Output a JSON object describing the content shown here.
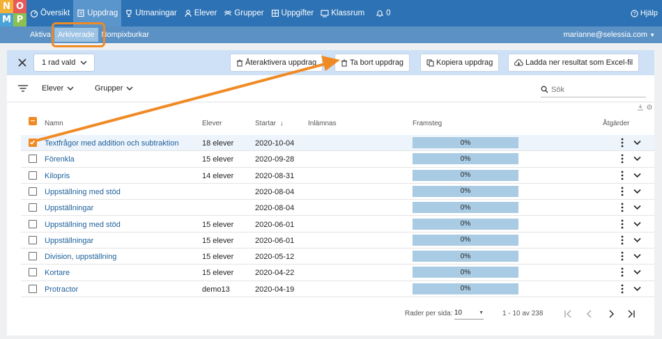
{
  "logo": [
    "N",
    "O",
    "M",
    "P"
  ],
  "nav": [
    {
      "label": "Översikt",
      "icon": "dashboard-icon"
    },
    {
      "label": "Uppdrag",
      "icon": "document-icon",
      "active": true
    },
    {
      "label": "Utmaningar",
      "icon": "trophy-icon"
    },
    {
      "label": "Elever",
      "icon": "person-icon"
    },
    {
      "label": "Grupper",
      "icon": "group-icon"
    },
    {
      "label": "Uppgifter",
      "icon": "grid-icon"
    },
    {
      "label": "Klassrum",
      "icon": "classroom-icon"
    },
    {
      "label": "0",
      "icon": "bell-icon"
    }
  ],
  "help_label": "Hjälp",
  "subnav": [
    {
      "label": "Aktiva"
    },
    {
      "label": "Arkiverade",
      "active": true
    },
    {
      "label": "Nompixburkar"
    }
  ],
  "user_email": "marianne@selessia.com",
  "actionbar": {
    "selected_label": "1 rad vald",
    "reactivate": "Återaktivera uppdrag",
    "delete": "Ta bort uppdrag",
    "copy": "Kopiera uppdrag",
    "download": "Ladda ner resultat som Excel-fil"
  },
  "filters": {
    "students": "Elever",
    "groups": "Grupper",
    "search_placeholder": "Sök"
  },
  "columns": {
    "name": "Namn",
    "students": "Elever",
    "starts": "Startar",
    "due": "Inlämnas",
    "progress": "Framsteg",
    "actions": "Åtgärder"
  },
  "rows": [
    {
      "name": "Textfrågor med addition och subtraktion",
      "students": "18 elever",
      "starts": "2020-10-04",
      "progress": "0%",
      "checked": true
    },
    {
      "name": "Förenkla",
      "students": "15 elever",
      "starts": "2020-09-28",
      "progress": "0%",
      "checked": false
    },
    {
      "name": "Kilopris",
      "students": "14 elever",
      "starts": "2020-08-31",
      "progress": "0%",
      "checked": false
    },
    {
      "name": "Uppställning med stöd",
      "students": "",
      "starts": "2020-08-04",
      "progress": "0%",
      "checked": false
    },
    {
      "name": "Uppställningar",
      "students": "",
      "starts": "2020-08-04",
      "progress": "0%",
      "checked": false
    },
    {
      "name": "Uppställning med stöd",
      "students": "15 elever",
      "starts": "2020-06-01",
      "progress": "0%",
      "checked": false
    },
    {
      "name": "Uppställningar",
      "students": "15 elever",
      "starts": "2020-06-01",
      "progress": "0%",
      "checked": false
    },
    {
      "name": "Division, uppställning",
      "students": "15 elever",
      "starts": "2020-05-12",
      "progress": "0%",
      "checked": false
    },
    {
      "name": "Kortare",
      "students": "15 elever",
      "starts": "2020-04-22",
      "progress": "0%",
      "checked": false
    },
    {
      "name": "Protractor",
      "students": "demo13",
      "starts": "2020-04-19",
      "progress": "0%",
      "checked": false
    }
  ],
  "footer": {
    "rows_per_page_label": "Rader per sida:",
    "rows_per_page": "10",
    "range": "1 - 10 av 238"
  },
  "colors": {
    "primary": "#2d72b4",
    "accent": "#f08a24",
    "progress": "#a9cbe3",
    "link": "#1f5f9a"
  }
}
